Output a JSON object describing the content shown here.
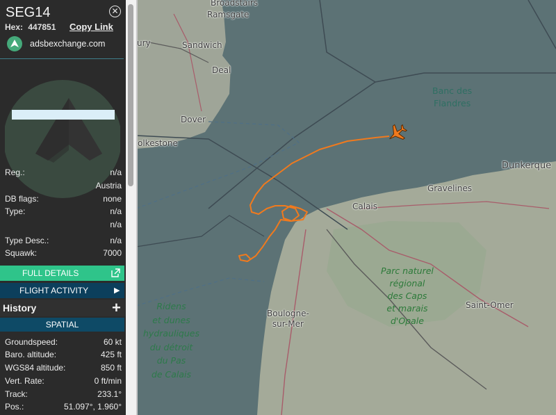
{
  "panel": {
    "callsign": "SEG14",
    "hex_label": "Hex:",
    "hex_value": "447851",
    "copy_link": "Copy Link",
    "source": "adsbexchange.com",
    "fields": [
      {
        "label": "Reg.:",
        "value": "n/a"
      },
      {
        "label": "",
        "value": "Austria"
      },
      {
        "label": "DB flags:",
        "value": "none"
      },
      {
        "label": "Type:",
        "value": "n/a"
      },
      {
        "label": "",
        "value": "n/a"
      },
      {
        "label": "Type Desc.:",
        "value": "n/a"
      },
      {
        "label": "Squawk:",
        "value": "7000"
      }
    ],
    "full_details": "FULL DETAILS",
    "flight_activity": "FLIGHT ACTIVITY",
    "history": "History",
    "spatial": "SPATIAL",
    "spatial_fields": [
      {
        "label": "Groundspeed:",
        "value": "60 kt"
      },
      {
        "label": "Baro. altitude:",
        "value": "425 ft"
      },
      {
        "label": "WGS84 altitude:",
        "value": "850 ft"
      },
      {
        "label": "Vert. Rate:",
        "value": "0 ft/min"
      },
      {
        "label": "Track:",
        "value": "233.1°"
      },
      {
        "label": "Pos.:",
        "value": "51.097°, 1.960°"
      }
    ]
  },
  "map": {
    "places": {
      "broadstairs": "Broadstairs",
      "ramsgate": "Ramsgate",
      "sandwich": "Sandwich",
      "deal": "Deal",
      "dover": "Dover",
      "folkestone": "olkestone",
      "ury": "ury",
      "dunkerque": "Dunkerque",
      "gravelines": "Gravelines",
      "calais": "Calais",
      "boulogne": "Boulogne-\nsur-Mer",
      "saint_omer": "Saint-Omer"
    },
    "banc": "Banc des\nFlandres",
    "park": "Parc naturel\nrégional\ndes Caps\net marais\nd'Opale",
    "ridens": "Ridens\net dunes\nhydrauliques\ndu détroit\ndu Pas\nde Calais"
  },
  "colors": {
    "track": "#f07a1e",
    "accent_green": "#2fc48a",
    "accent_blue": "#0c3f5c",
    "panel_bg": "#2b2b2b",
    "sea": "#5c7275"
  },
  "icons": {
    "close": "close-circle-icon",
    "source_logo": "adsbexchange-logo-icon",
    "external": "external-link-icon",
    "chevron": "chevron-right-icon",
    "plus": "plus-icon",
    "aircraft": "aircraft-marker-icon"
  }
}
